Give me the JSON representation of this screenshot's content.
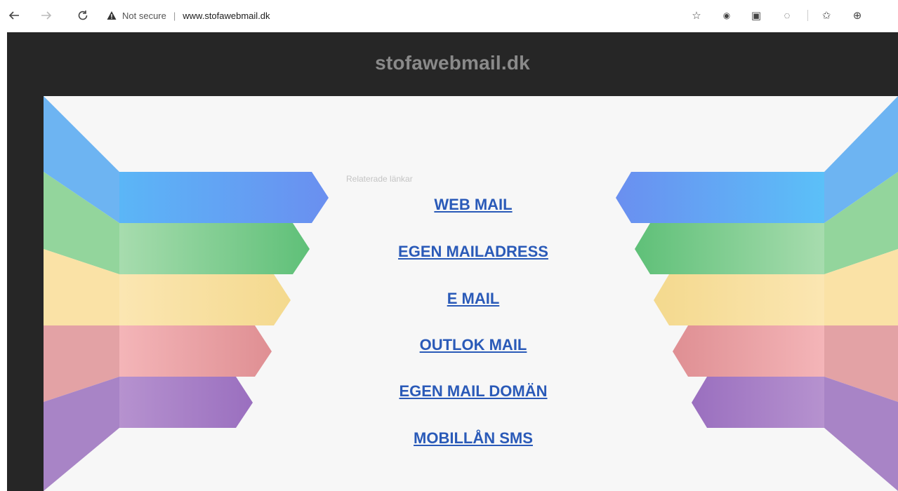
{
  "browser": {
    "back_icon": "back-arrow-icon",
    "forward_icon": "forward-arrow-icon",
    "refresh_icon": "refresh-icon",
    "security_label": "Not secure",
    "url": "www.stofawebmail.dk",
    "toolbar_icons": [
      "favorites-add-icon",
      "extension-icon",
      "extension-icon",
      "extension-icon",
      "favorites-icon",
      "collections-icon"
    ]
  },
  "page": {
    "site_title": "stofawebmail.dk",
    "related_label": "Relaterade länkar",
    "links": [
      "WEB MAIL",
      "EGEN MAILADRESS",
      "E MAIL",
      "OUTLOK MAIL",
      "EGEN MAIL DOMÄN",
      "MOBILLÅN SMS"
    ]
  },
  "colors": {
    "background": "#262626",
    "panel": "#f7f7f7",
    "link": "#2a5ab8",
    "title": "#8a8a8a",
    "blue": "#5aa8f5",
    "green": "#7ccf8a",
    "yellow": "#f7dd9a",
    "red": "#e9a0a4",
    "purple": "#a97ec2"
  }
}
